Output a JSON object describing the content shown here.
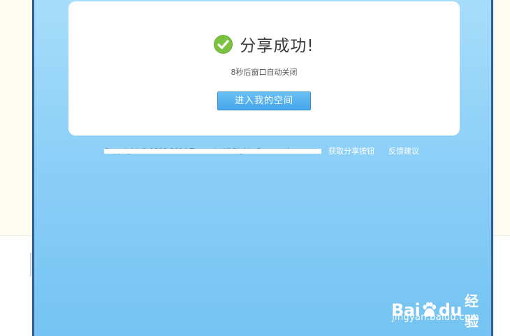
{
  "dialog": {
    "title": "分享成功!",
    "countdown_text": "8秒后窗口自动关闭",
    "enter_space_button": "进入我的空间",
    "check_icon": "check-circle-icon"
  },
  "footer": {
    "copyright_text": "Copyright © 1998-2014 Tencent. All Rights Reserved.",
    "links": [
      "获取分享按钮",
      "反馈建议"
    ]
  },
  "watermark": {
    "brand_left": "Bai",
    "brand_right": "du",
    "product": "经验",
    "url": "jingyan.baidu.com",
    "paw_icon": "baidu-paw-icon"
  },
  "colors": {
    "frame_border": "#2f5d9b",
    "gradient_top": "#a7dcfb",
    "gradient_bottom": "#74c3f2",
    "check_green": "#7cc242",
    "button_blue": "#45a6ea"
  }
}
